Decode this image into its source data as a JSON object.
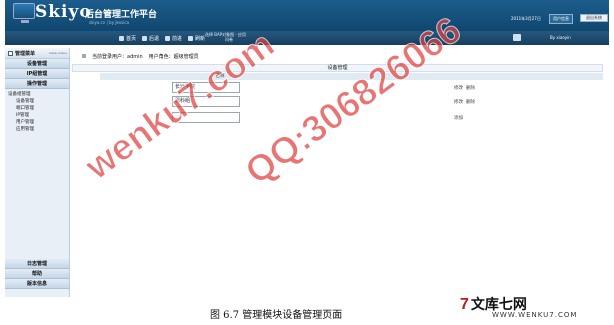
{
  "header": {
    "logo": "Skiyo",
    "title": "后台管理工作平台",
    "url": "skiyo.cn | by Jessica",
    "date": "2011年3月27日",
    "user_info_label": "用户信息",
    "exit_label": "退出系统"
  },
  "nav": {
    "items": [
      {
        "label": "首页"
      },
      {
        "label": "后退"
      },
      {
        "label": "前进"
      },
      {
        "label": "刷新"
      }
    ],
    "extra_line1": "选择 BAP对象图 · 应用",
    "extra_line2": "问卷",
    "right_text": "By xiaoyin"
  },
  "sidebar": {
    "title": "管理菜单",
    "title_en": "menu menu",
    "sections_top": [
      "设备管理",
      "IP组管理",
      "操作管理"
    ],
    "items": [
      {
        "label": "设备组管理",
        "child": false
      },
      {
        "label": "设备管理",
        "child": true
      },
      {
        "label": "端口管理",
        "child": true
      },
      {
        "label": "IP管理",
        "child": true
      },
      {
        "label": "用户管理",
        "child": true
      },
      {
        "label": "应用管理",
        "child": true
      }
    ],
    "sections_bottom": [
      "日志管理",
      "帮助",
      "版本信息"
    ]
  },
  "main": {
    "crumb_user": "当前登录用户：admin",
    "crumb_role": "用户角色：超级管理员",
    "panel_title": "设备管理",
    "col_name": "名称",
    "rows": [
      {
        "value": "长沙学院",
        "op1": "修改",
        "op2": "删除"
      },
      {
        "value": "恩科组",
        "op1": "修改",
        "op2": "删除"
      },
      {
        "value": "",
        "op1": "添加",
        "op2": ""
      }
    ]
  },
  "caption": "图 6.7 管理模块设备管理页面",
  "watermark": {
    "line1": "wenku7.com",
    "line2": "QQ:306826066",
    "site_mark": "7",
    "site_name": "文库七网",
    "site_url": "WWW.WENKU7.COM"
  }
}
